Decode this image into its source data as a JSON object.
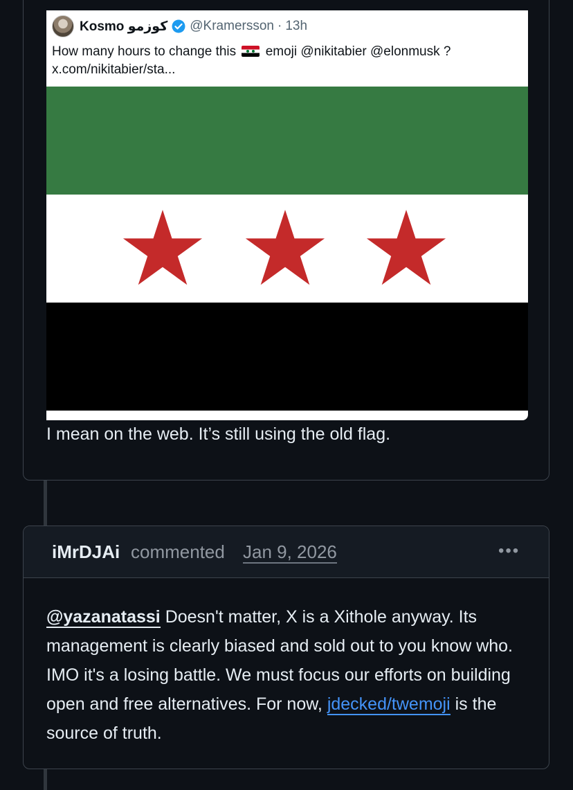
{
  "comment_1": {
    "embed": {
      "name": "Kosmo كوزمو",
      "handle": "@Kramersson",
      "separator": "·",
      "time": "13h",
      "text_before_emoji": "How many hours to change this",
      "text_after_emoji": "emoji @nikitabier @elonmusk ?",
      "link": "x.com/nikitabier/sta...",
      "flag_colors": {
        "top": "#367a42",
        "middle": "#ffffff",
        "bottom": "#000000",
        "star": "#c42a2a"
      }
    },
    "body": "I mean on the web. It’s still using the old flag."
  },
  "comment_2": {
    "author": "iMrDJAi",
    "action": "commented",
    "date": "Jan 9, 2026",
    "more_label": "•••",
    "mention": "@yazanatassi",
    "body_main": " Doesn't matter, X is a Xithole anyway. Its management is clearly biased and sold out to you know who. IMO it's a losing battle. We must focus our efforts on building open and free alternatives. For now, ",
    "link_text": "jdecked/twemoji",
    "body_end": " is the source of truth."
  }
}
